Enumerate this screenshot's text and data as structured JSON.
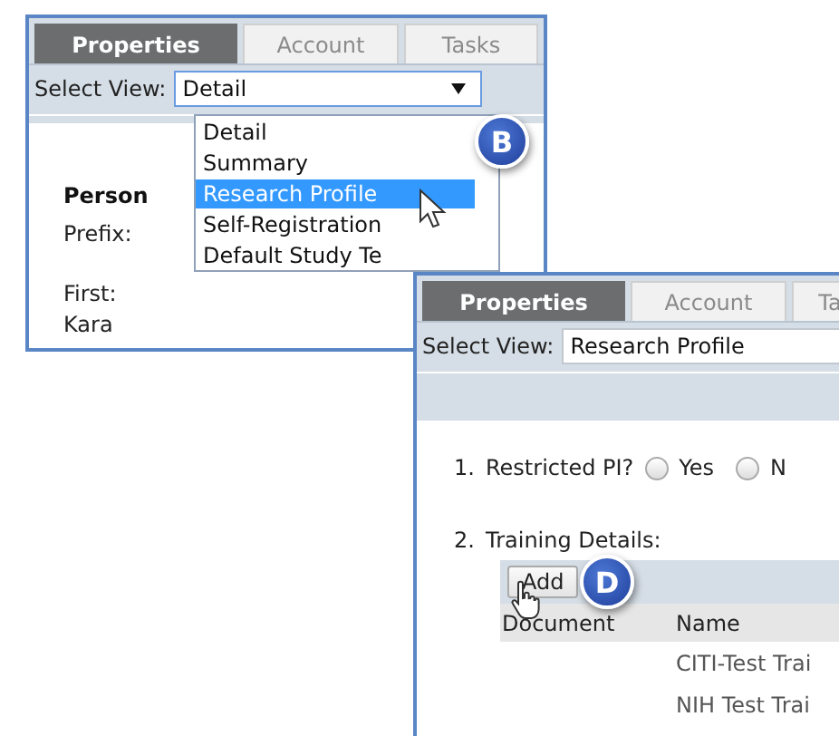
{
  "view_panel": {
    "tabs": [
      {
        "label": "Properties",
        "selected": true
      },
      {
        "label": "Account",
        "selected": false
      },
      {
        "label": "Tasks",
        "selected": false
      }
    ],
    "select_view": {
      "label": "Select View:",
      "value": "Detail",
      "open": true
    },
    "options": [
      {
        "label": "Detail",
        "selected": false
      },
      {
        "label": "Summary",
        "selected": false
      },
      {
        "label": "Research Profile",
        "selected": true
      },
      {
        "label": "Self-Registration",
        "selected": false
      },
      {
        "label": "Default Study Te",
        "selected": false
      }
    ],
    "badge": "B",
    "section_title": "Person",
    "fields": [
      {
        "label": "Prefix:"
      },
      {
        "label": "First:",
        "value": "Kara"
      }
    ]
  },
  "profile_panel": {
    "tabs": [
      {
        "label": "Properties",
        "selected": true
      },
      {
        "label": "Account",
        "selected": false
      },
      {
        "label": "Ta",
        "selected": false
      }
    ],
    "select_view": {
      "label": "Select View:",
      "value": "Research Profile",
      "open": false
    },
    "questions": [
      {
        "number": "1.",
        "label": "Restricted PI?",
        "kind": "radio",
        "options": [
          {
            "label": "Yes",
            "selected": false
          },
          {
            "label": "N",
            "selected": false
          }
        ]
      },
      {
        "number": "2.",
        "label": "Training Details:",
        "kind": "table",
        "button": "Add",
        "columns": [
          "Document",
          "Name"
        ],
        "rows": [
          [
            "",
            "CITI-Test Trai"
          ],
          [
            "",
            "NIH Test Trai"
          ]
        ]
      }
    ],
    "badge": "D"
  }
}
